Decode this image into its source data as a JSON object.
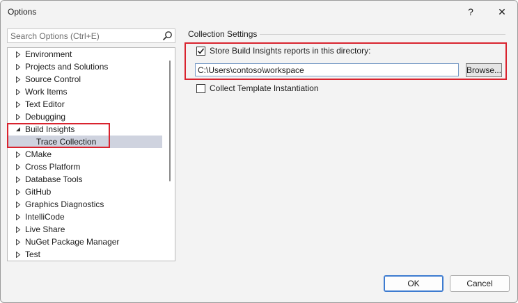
{
  "window": {
    "title": "Options",
    "help_glyph": "?",
    "close_glyph": "✕"
  },
  "search": {
    "placeholder": "Search Options (Ctrl+E)",
    "value": ""
  },
  "tree": {
    "items": [
      {
        "label": "Environment",
        "expanded": false,
        "selected": false,
        "indent": 0
      },
      {
        "label": "Projects and Solutions",
        "expanded": false,
        "selected": false,
        "indent": 0
      },
      {
        "label": "Source Control",
        "expanded": false,
        "selected": false,
        "indent": 0
      },
      {
        "label": "Work Items",
        "expanded": false,
        "selected": false,
        "indent": 0
      },
      {
        "label": "Text Editor",
        "expanded": false,
        "selected": false,
        "indent": 0
      },
      {
        "label": "Debugging",
        "expanded": false,
        "selected": false,
        "indent": 0
      },
      {
        "label": "Build Insights",
        "expanded": true,
        "selected": false,
        "indent": 0
      },
      {
        "label": "Trace Collection",
        "expanded": null,
        "selected": true,
        "indent": 1
      },
      {
        "label": "CMake",
        "expanded": false,
        "selected": false,
        "indent": 0
      },
      {
        "label": "Cross Platform",
        "expanded": false,
        "selected": false,
        "indent": 0
      },
      {
        "label": "Database Tools",
        "expanded": false,
        "selected": false,
        "indent": 0
      },
      {
        "label": "GitHub",
        "expanded": false,
        "selected": false,
        "indent": 0
      },
      {
        "label": "Graphics Diagnostics",
        "expanded": false,
        "selected": false,
        "indent": 0
      },
      {
        "label": "IntelliCode",
        "expanded": false,
        "selected": false,
        "indent": 0
      },
      {
        "label": "Live Share",
        "expanded": false,
        "selected": false,
        "indent": 0
      },
      {
        "label": "NuGet Package Manager",
        "expanded": false,
        "selected": false,
        "indent": 0
      },
      {
        "label": "Test",
        "expanded": false,
        "selected": false,
        "indent": 0
      }
    ]
  },
  "main": {
    "group_title": "Collection Settings",
    "store_reports": {
      "label": "Store Build Insights reports in this directory:",
      "checked": true
    },
    "directory": {
      "value": "C:\\Users\\contoso\\workspace"
    },
    "browse_label": "Browse...",
    "collect_templates": {
      "label": "Collect Template Instantiation",
      "checked": false
    }
  },
  "footer": {
    "ok_label": "OK",
    "cancel_label": "Cancel"
  },
  "colors": {
    "highlight_red": "#d9232e",
    "selection": "#cfd3df",
    "accent_blue": "#3d7bd0"
  }
}
